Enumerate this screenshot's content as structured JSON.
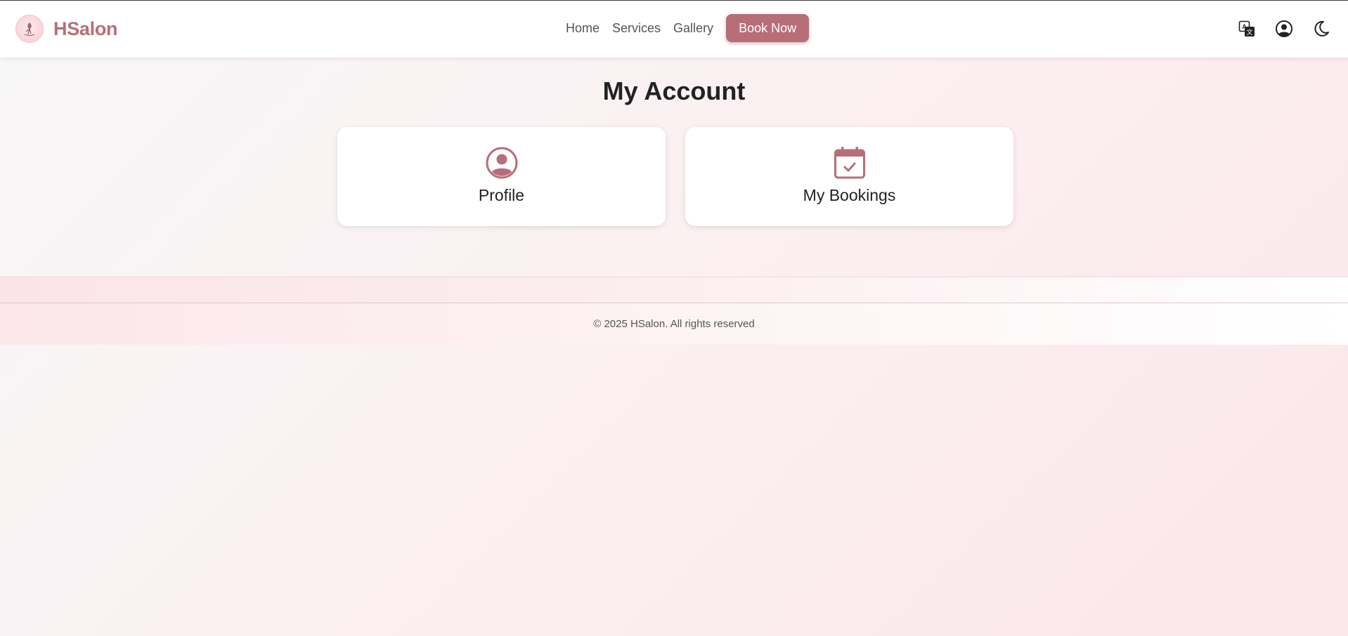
{
  "brand": {
    "name": "HSalon",
    "logo_icon": "salon-logo-icon"
  },
  "nav": {
    "links": [
      "Home",
      "Services",
      "Gallery"
    ],
    "book_label": "Book Now"
  },
  "header_icons": [
    "translate-icon",
    "user-circle-icon",
    "moon-icon"
  ],
  "main": {
    "title": "My Account",
    "cards": [
      {
        "label": "Profile",
        "icon": "user-circle-icon"
      },
      {
        "label": "My Bookings",
        "icon": "calendar-check-icon"
      }
    ]
  },
  "footer": {
    "text": "© 2025 HSalon. All rights reserved"
  },
  "colors": {
    "accent": "#b76e79",
    "text": "#222222",
    "muted": "#555555"
  }
}
